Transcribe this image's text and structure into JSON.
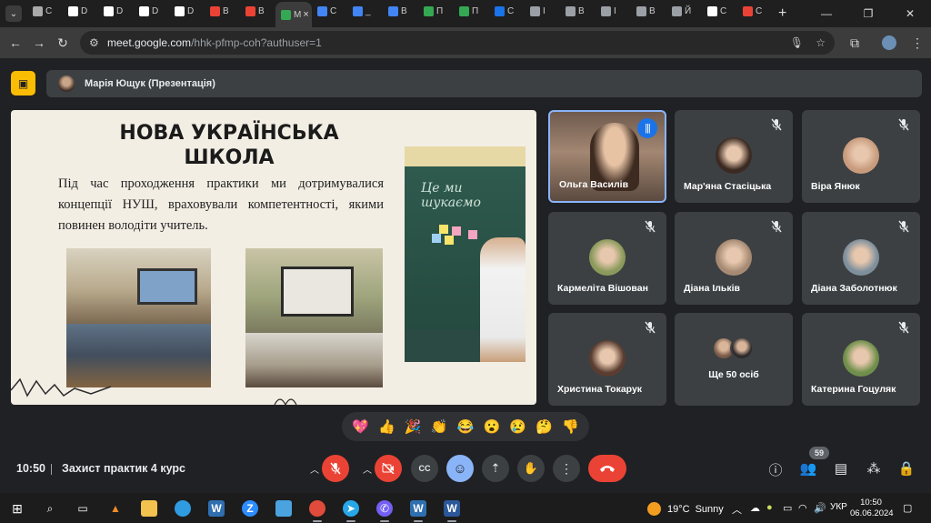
{
  "browser": {
    "tabs": [
      {
        "label": "C",
        "color": "#aaaaaa"
      },
      {
        "label": "D",
        "color": "#ffffff"
      },
      {
        "label": "D",
        "color": "#ffffff"
      },
      {
        "label": "D",
        "color": "#ffffff"
      },
      {
        "label": "D",
        "color": "#ffffff"
      },
      {
        "label": "B",
        "color": "#ea4335"
      },
      {
        "label": "B",
        "color": "#ea4335"
      },
      {
        "label": "M",
        "color": "#34a853",
        "active": true
      },
      {
        "label": "C",
        "color": "#4285f4"
      },
      {
        "label": "_",
        "color": "#4285f4"
      },
      {
        "label": "B",
        "color": "#4285f4"
      },
      {
        "label": "П",
        "color": "#34a853"
      },
      {
        "label": "П",
        "color": "#34a853"
      },
      {
        "label": "C",
        "color": "#1a73e8"
      },
      {
        "label": "I",
        "color": "#9aa0a6"
      },
      {
        "label": "B",
        "color": "#9aa0a6"
      },
      {
        "label": "I",
        "color": "#9aa0a6"
      },
      {
        "label": "B",
        "color": "#9aa0a6"
      },
      {
        "label": "Й",
        "color": "#9aa0a6"
      },
      {
        "label": "C",
        "color": "#ffffff"
      },
      {
        "label": "C",
        "color": "#ea4335"
      }
    ],
    "active_tab_close": "×",
    "new_tab": "+",
    "url_host": "meet.google.com",
    "url_path": "/hhk-pfmp-coh?authuser=1"
  },
  "meet": {
    "presenter_name": "Марія Ющук (Презентація)",
    "slide": {
      "title_line1": "НОВА УКРАЇНСЬКА",
      "title_line2": "ШКОЛА",
      "body": "Під час проходження практики ми дотримувалися концепції НУШ, враховували компетентності, якими повинен володіти учитель.",
      "chalk_text": "Це   ми шукаємо"
    },
    "participants": [
      {
        "name": "Ольга Василів",
        "speaking": true
      },
      {
        "name": "Мар'яна Стасіцька",
        "avatar_color": "#3b2a22"
      },
      {
        "name": "Віра Янюк",
        "avatar_color": "#c99b7d"
      },
      {
        "name": "Кармеліта Вішован",
        "avatar_color": "#8a9a5b"
      },
      {
        "name": "Діана Ільків",
        "avatar_color": "#a68a73"
      },
      {
        "name": "Діана Заболотнюк",
        "avatar_color": "#7e8f9c"
      },
      {
        "name": "Христина Токарук",
        "avatar_color": "#5a3d30"
      },
      {
        "name": "Ще 50 осіб",
        "more": true
      },
      {
        "name": "Катерина Гоцуляк",
        "avatar_color": "#6f8f4a"
      }
    ],
    "reactions": [
      "💖",
      "👍",
      "🎉",
      "👏",
      "😂",
      "😮",
      "😢",
      "🤔",
      "👎"
    ],
    "clock": "10:50",
    "meeting_title": "Захист практик 4 курс",
    "people_count": "59"
  },
  "taskbar": {
    "temperature": "19°C",
    "weather": "Sunny",
    "language": "УКР",
    "time": "10:50",
    "date": "06.06.2024"
  }
}
